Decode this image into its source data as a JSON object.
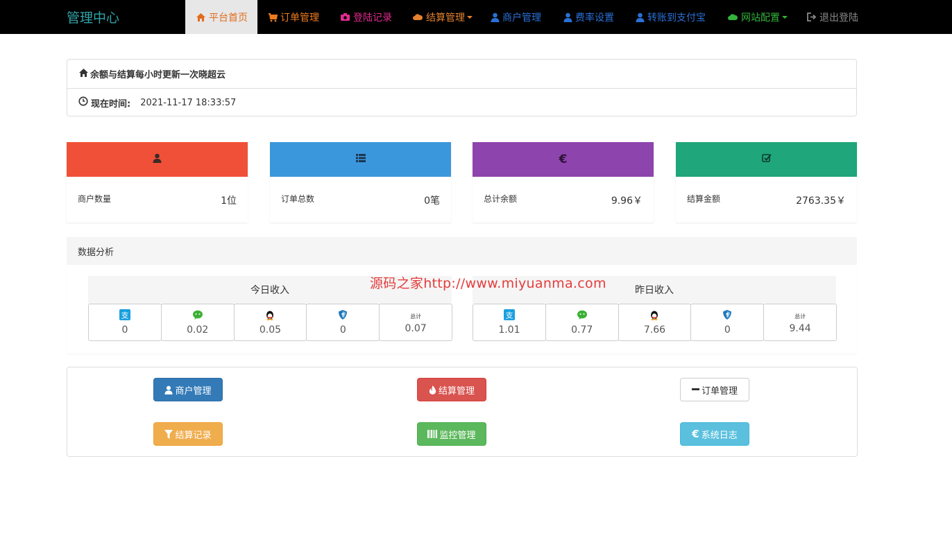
{
  "navbar": {
    "brand": "管理中心",
    "items": [
      {
        "label": "平台首页",
        "icon": "home-icon",
        "color": "#e06c1d",
        "active": true
      },
      {
        "label": "订单管理",
        "icon": "cart-icon",
        "color": "#ef7b1e"
      },
      {
        "label": "登陆记录",
        "icon": "camera-icon",
        "color": "#e12b8e"
      },
      {
        "label": "结算管理",
        "icon": "cloud-icon",
        "color": "#e5812e",
        "dropdown": true
      },
      {
        "label": "商户管理",
        "icon": "user-icon",
        "color": "#2a70d6"
      },
      {
        "label": "费率设置",
        "icon": "user-icon",
        "color": "#2a70d6"
      },
      {
        "label": "转账到支付宝",
        "icon": "user-icon",
        "color": "#2a70d6"
      },
      {
        "label": "网站配置",
        "icon": "cloud-icon",
        "color": "#33b33a",
        "dropdown": true
      },
      {
        "label": "退出登陆",
        "icon": "logout-icon",
        "color": "#8a8a8a"
      }
    ]
  },
  "info": {
    "notice": "余额与结算每小时更新一次晓超云",
    "time_label": "现在时间:",
    "time_value": "2021-11-17 18:33:57"
  },
  "stats": [
    {
      "icon": "user-icon",
      "color": "#f05037",
      "label": "商户数量",
      "value": "1位"
    },
    {
      "icon": "list-icon",
      "color": "#3b97dc",
      "label": "订单总数",
      "value": "0笔"
    },
    {
      "icon": "euro-icon",
      "color": "#8e44ad",
      "label": "总计余额",
      "value": "9.96￥"
    },
    {
      "icon": "check-icon",
      "color": "#1fa67a",
      "label": "结算金额",
      "value": "2763.35￥"
    }
  ],
  "analysis": {
    "title": "数据分析",
    "today": {
      "title": "今日收入",
      "cells": [
        {
          "icon": "alipay-icon",
          "value": "0"
        },
        {
          "icon": "wechat-icon",
          "value": "0.02"
        },
        {
          "icon": "qq-icon",
          "value": "0.05"
        },
        {
          "icon": "shield-icon",
          "value": "0"
        },
        {
          "icon": "total-icon",
          "icon_text": "总计",
          "value": "0.07"
        }
      ]
    },
    "yesterday": {
      "title": "昨日收入",
      "cells": [
        {
          "icon": "alipay-icon",
          "value": "1.01"
        },
        {
          "icon": "wechat-icon",
          "value": "0.77"
        },
        {
          "icon": "qq-icon",
          "value": "7.66"
        },
        {
          "icon": "shield-icon",
          "value": "0"
        },
        {
          "icon": "total-icon",
          "icon_text": "总计",
          "value": "9.44"
        }
      ]
    }
  },
  "watermark": "源码之家http://www.miyuanma.com",
  "buttons": [
    {
      "label": "商户管理",
      "icon": "user-icon",
      "style": "primary"
    },
    {
      "label": "结算管理",
      "icon": "fire-icon",
      "style": "danger"
    },
    {
      "label": "订单管理",
      "icon": "minus-icon",
      "style": "default"
    },
    {
      "label": "结算记录",
      "icon": "filter-icon",
      "style": "warning"
    },
    {
      "label": "监控管理",
      "icon": "barcode-icon",
      "style": "success"
    },
    {
      "label": "系统日志",
      "icon": "euro-icon",
      "style": "info"
    }
  ]
}
